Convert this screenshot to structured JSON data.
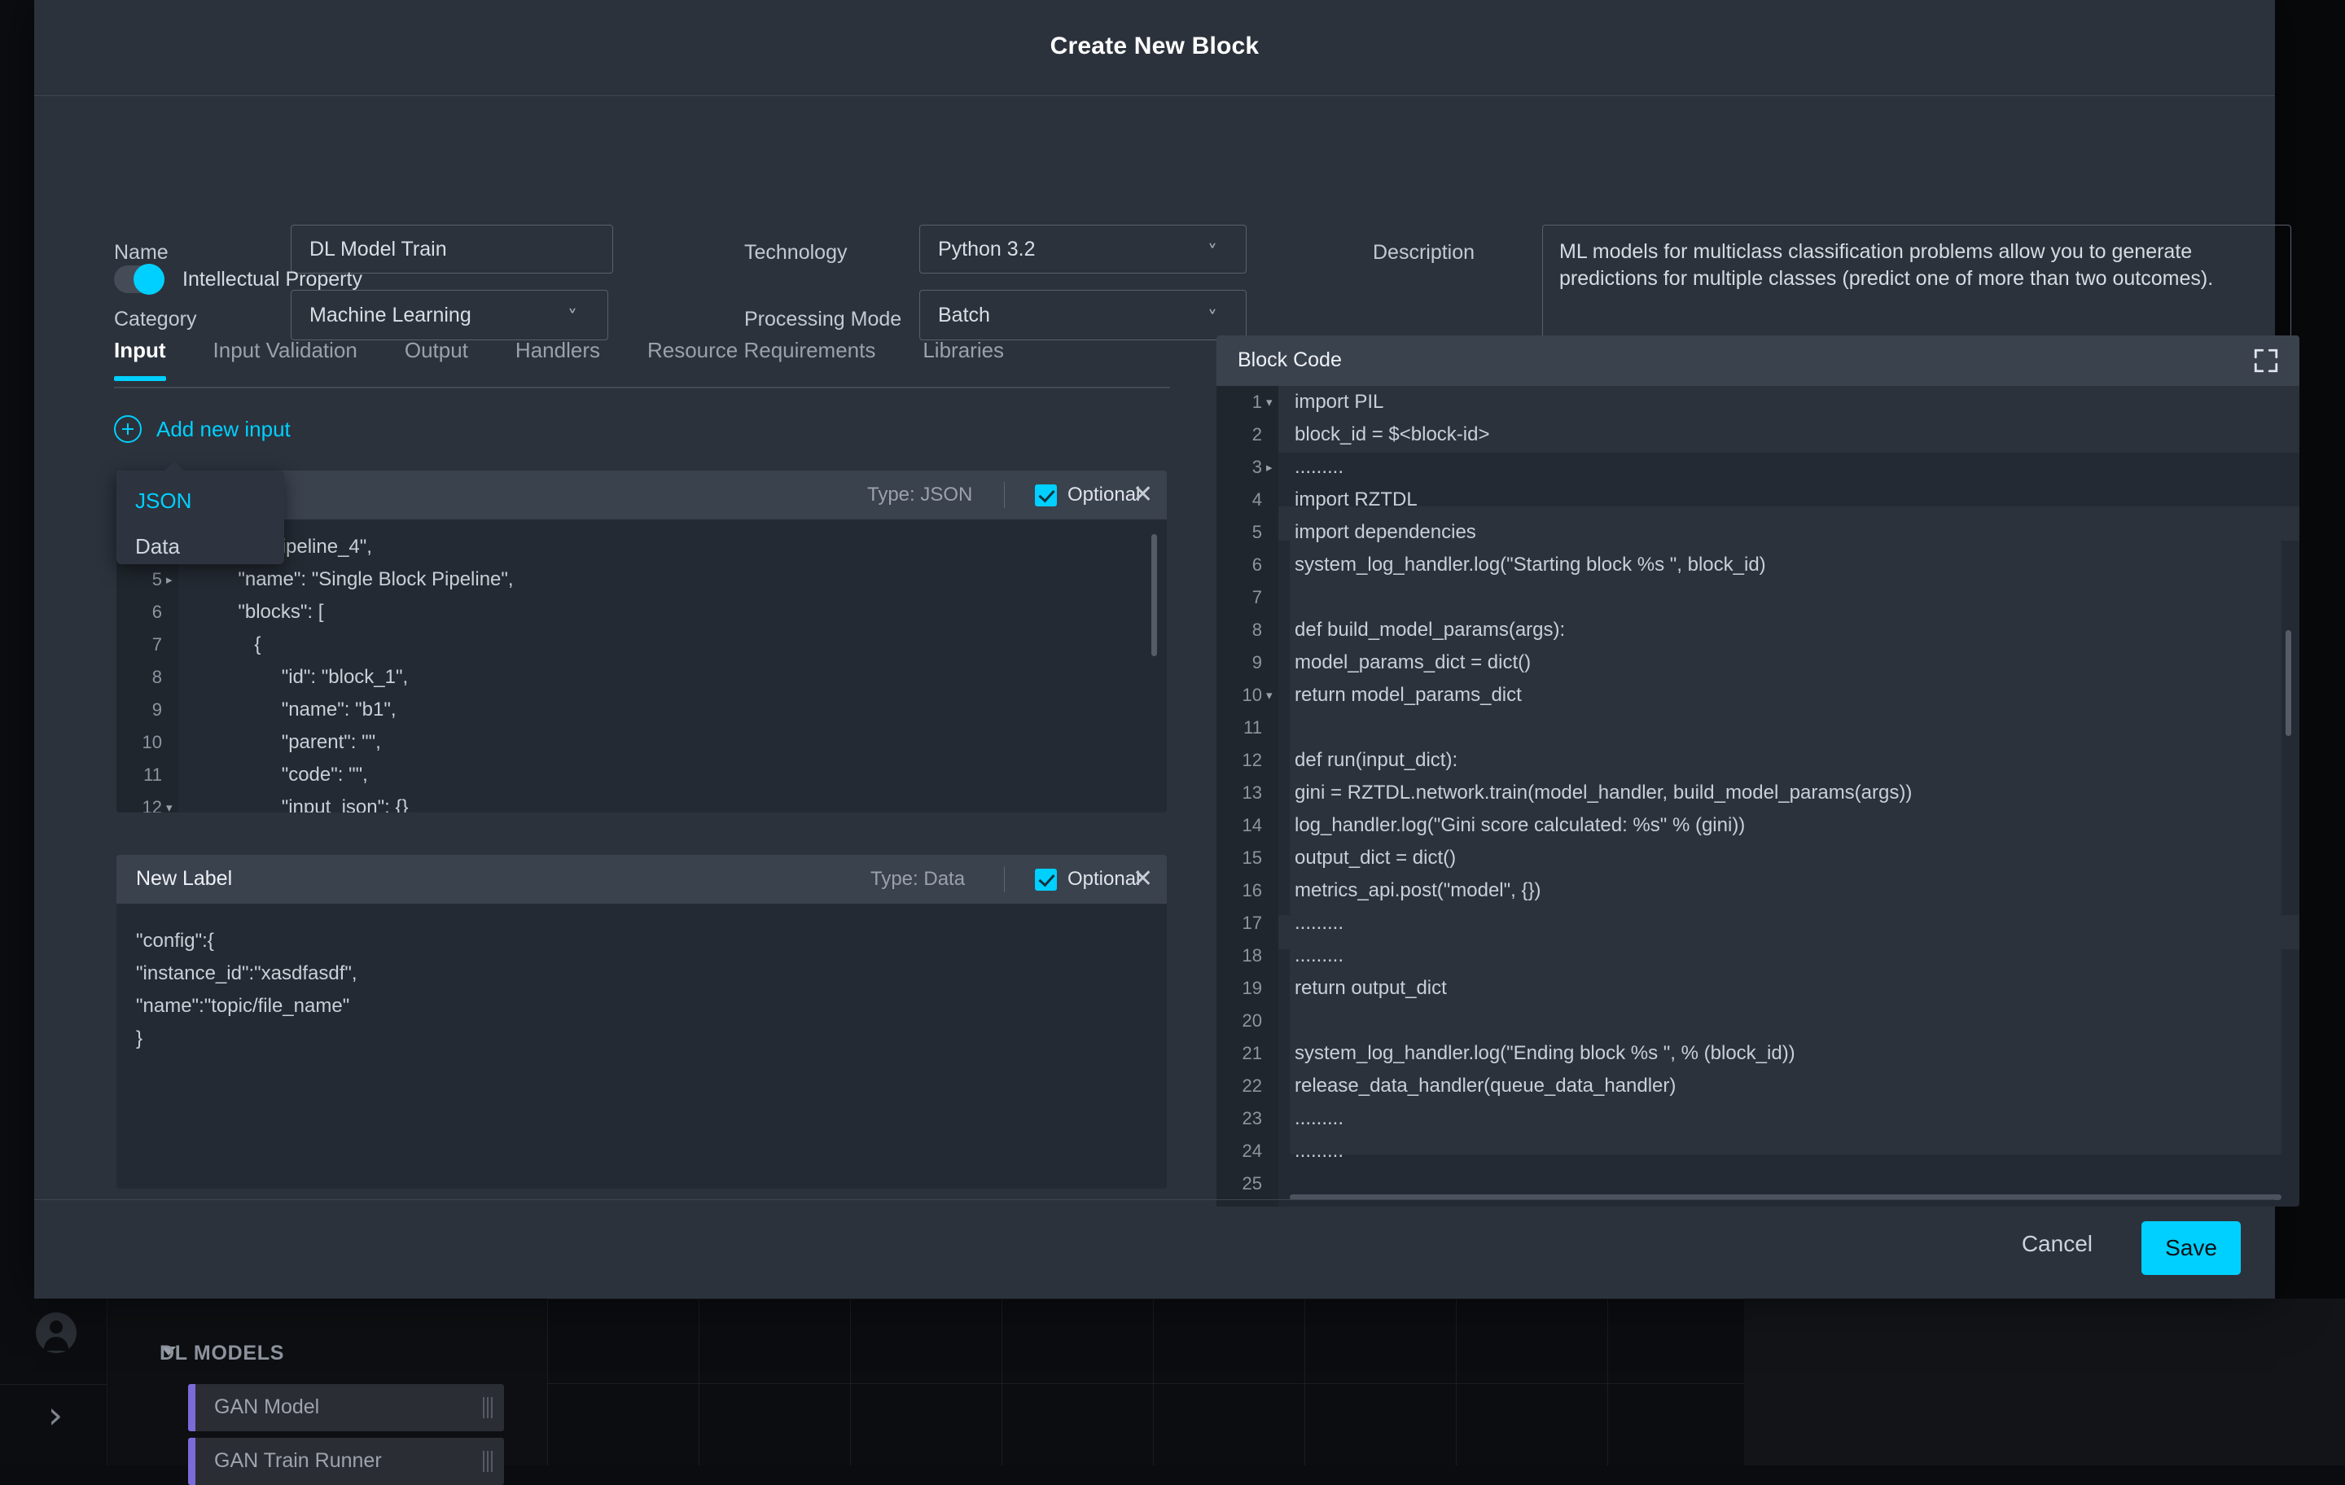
{
  "modal": {
    "title": "Create New Block",
    "footer": {
      "cancel_label": "Cancel",
      "save_label": "Save"
    },
    "accent_color": "#00d0ff",
    "panel_header_color": "#3a424e",
    "surface_color": "#2b323c"
  },
  "form": {
    "name": {
      "label": "Name",
      "value": "DL Model Train"
    },
    "category": {
      "label": "Category",
      "value": "Machine Learning"
    },
    "technology": {
      "label": "Technology",
      "value": "Python 3.2"
    },
    "processing_mode": {
      "label": "Processing Mode",
      "value": "Batch"
    },
    "description": {
      "label": "Description",
      "value": "ML models for multiclass classification problems allow you to generate predictions for multiple classes (predict one of more than two outcomes)."
    },
    "intellectual_property": {
      "label": "Intellectual Property",
      "enabled": "on"
    }
  },
  "tabs": [
    {
      "label": "Input",
      "active": "true"
    },
    {
      "label": "Input Validation",
      "active": "false"
    },
    {
      "label": "Output",
      "active": "false"
    },
    {
      "label": "Handlers",
      "active": "false"
    },
    {
      "label": "Resource Requirements",
      "active": "false"
    },
    {
      "label": "Libraries",
      "active": "false"
    }
  ],
  "add_input": {
    "label": "Add new input",
    "icon": "plus-circle-icon"
  },
  "type_menu": {
    "selected": "JSON",
    "options": [
      "JSON",
      "Data"
    ]
  },
  "input_panels": [
    {
      "title": "",
      "type_label": "Type: JSON",
      "optional_label": "Optional",
      "optional_checked": "true",
      "close_label": "✕",
      "editor": {
        "lines": [
          {
            "num": "",
            "fold": "",
            "code": "              pipeline_4\","
          },
          {
            "num": "5",
            "fold": "▸",
            "code": "        \"name\": \"Single Block Pipeline\","
          },
          {
            "num": "6",
            "fold": "",
            "code": "        \"blocks\": ["
          },
          {
            "num": "7",
            "fold": "",
            "code": "           {"
          },
          {
            "num": "8",
            "fold": "",
            "code": "                \"id\": \"block_1\","
          },
          {
            "num": "9",
            "fold": "",
            "code": "                \"name\": \"b1\","
          },
          {
            "num": "10",
            "fold": "",
            "code": "                \"parent\": \"\","
          },
          {
            "num": "11",
            "fold": "",
            "code": "                \"code\": \"\","
          },
          {
            "num": "12",
            "fold": "▾",
            "code": "                \"input_json\": {}"
          }
        ]
      }
    },
    {
      "title": "New Label",
      "type_label": "Type: Data",
      "optional_label": "Optional",
      "optional_checked": "true",
      "close_label": "✕",
      "data_lines": [
        "\"config\":{",
        "\"instance_id\":\"xasdfasdf\",",
        "\"name\":\"topic/file_name\"",
        "}"
      ]
    }
  ],
  "block_code": {
    "title": "Block Code",
    "expand_icon": "expand-fullscreen-icon",
    "lines": [
      {
        "num": "1",
        "fold": "▾",
        "code": "import PIL"
      },
      {
        "num": "2",
        "fold": "",
        "code": "block_id = $<block-id>"
      },
      {
        "num": "3",
        "fold": "▸",
        "code": "........."
      },
      {
        "num": "4",
        "fold": "",
        "code": "import RZTDL"
      },
      {
        "num": "5",
        "fold": "",
        "code": "import dependencies"
      },
      {
        "num": "6",
        "fold": "",
        "code": "system_log_handler.log(\"Starting block %s \", block_id)"
      },
      {
        "num": "7",
        "fold": "",
        "code": ""
      },
      {
        "num": "8",
        "fold": "",
        "code": "def build_model_params(args):"
      },
      {
        "num": "9",
        "fold": "",
        "code": "model_params_dict = dict()"
      },
      {
        "num": "10",
        "fold": "▾",
        "code": "return model_params_dict"
      },
      {
        "num": "11",
        "fold": "",
        "code": ""
      },
      {
        "num": "12",
        "fold": "",
        "code": "def run(input_dict):"
      },
      {
        "num": "13",
        "fold": "",
        "code": "gini = RZTDL.network.train(model_handler, build_model_params(args))"
      },
      {
        "num": "14",
        "fold": "",
        "code": "log_handler.log(\"Gini score calculated: %s\" % (gini))"
      },
      {
        "num": "15",
        "fold": "",
        "code": "output_dict = dict()"
      },
      {
        "num": "16",
        "fold": "",
        "code": "metrics_api.post(\"model\", {})"
      },
      {
        "num": "17",
        "fold": "",
        "code": "........."
      },
      {
        "num": "18",
        "fold": "",
        "code": "........."
      },
      {
        "num": "19",
        "fold": "",
        "code": "return output_dict"
      },
      {
        "num": "20",
        "fold": "",
        "code": ""
      },
      {
        "num": "21",
        "fold": "",
        "code": "system_log_handler.log(\"Ending block %s \", % (block_id))"
      },
      {
        "num": "22",
        "fold": "",
        "code": "release_data_handler(queue_data_handler)"
      },
      {
        "num": "23",
        "fold": "",
        "code": "........."
      },
      {
        "num": "24",
        "fold": "",
        "code": "........."
      },
      {
        "num": "25",
        "fold": "",
        "code": ""
      }
    ]
  },
  "background": {
    "section_title": "DL MODELS",
    "models": [
      "GAN Model",
      "GAN Train Runner"
    ],
    "accent_color": "#7a6bd8"
  }
}
